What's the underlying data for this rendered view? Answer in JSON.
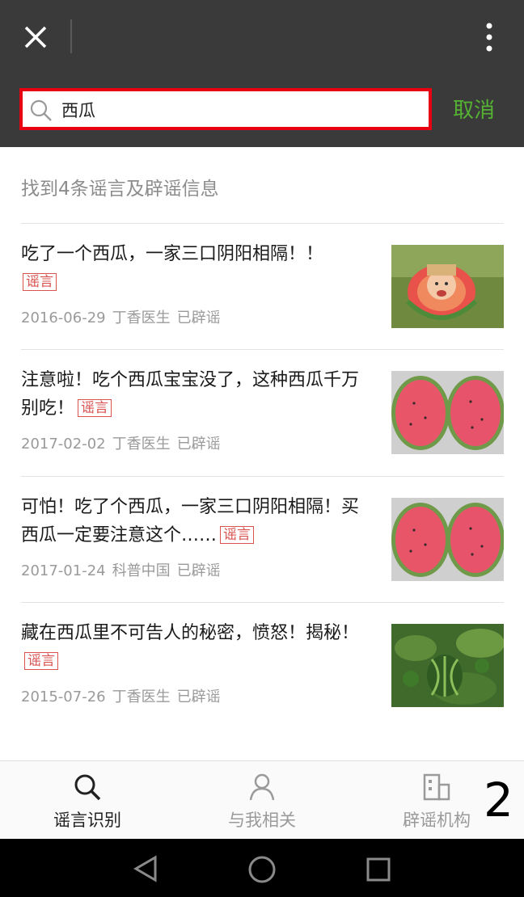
{
  "header": {
    "search_value": "西瓜",
    "cancel_label": "取消"
  },
  "results": {
    "summary": "找到4条谣言及辟谣信息",
    "tag_label": "谣言",
    "items": [
      {
        "title": "吃了一个西瓜，一家三口阴阳相隔！！",
        "date": "2016-06-29",
        "source": "丁香医生",
        "status": "已辟谣"
      },
      {
        "title": "注意啦！吃个西瓜宝宝没了，这种西瓜千万别吃！",
        "date": "2017-02-02",
        "source": "丁香医生",
        "status": "已辟谣"
      },
      {
        "title": "可怕！吃了个西瓜，一家三口阴阳相隔！买西瓜一定要注意这个……",
        "date": "2017-01-24",
        "source": "科普中国",
        "status": "已辟谣"
      },
      {
        "title": "藏在西瓜里不可告人的秘密，愤怒！揭秘！",
        "date": "2015-07-26",
        "source": "丁香医生",
        "status": "已辟谣"
      }
    ]
  },
  "tabs": [
    {
      "label": "谣言识别",
      "icon": "search-icon",
      "active": true
    },
    {
      "label": "与我相关",
      "icon": "person-icon",
      "active": false
    },
    {
      "label": "辟谣机构",
      "icon": "building-icon",
      "active": false
    }
  ],
  "overlay_number": "2",
  "colors": {
    "accent_green": "#55b232",
    "highlight_red": "#e60012",
    "rumor_tag": "#d9534f",
    "topbar": "#3a3a3a"
  }
}
